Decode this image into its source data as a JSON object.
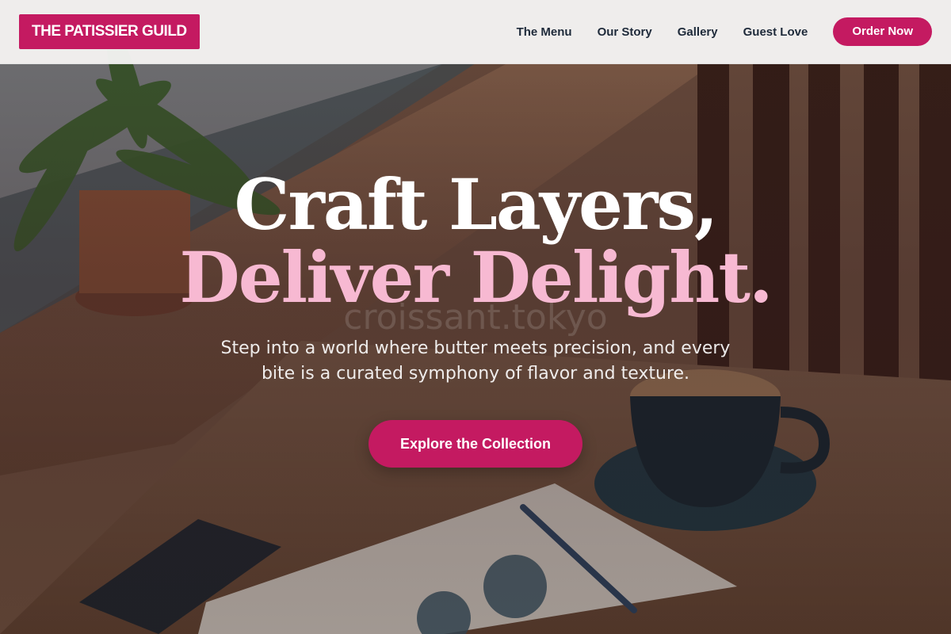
{
  "brand": {
    "name": "THE PATISSIER GUILD"
  },
  "nav": {
    "links": [
      "The Menu",
      "Our Story",
      "Gallery",
      "Guest Love"
    ],
    "order_label": "Order Now"
  },
  "hero": {
    "headline_line1": "Craft Layers,",
    "headline_line2": "Deliver Delight.",
    "watermark": "croissant.tokyo",
    "subtext": "Step into a world where butter meets precision, and every bite is a curated symphony of flavor and texture.",
    "cta_label": "Explore the Collection"
  },
  "colors": {
    "accent": "#c41a61",
    "accent_light": "#f7b9d2",
    "nav_text": "#1e2a3a",
    "nav_bg": "#fafafa"
  }
}
